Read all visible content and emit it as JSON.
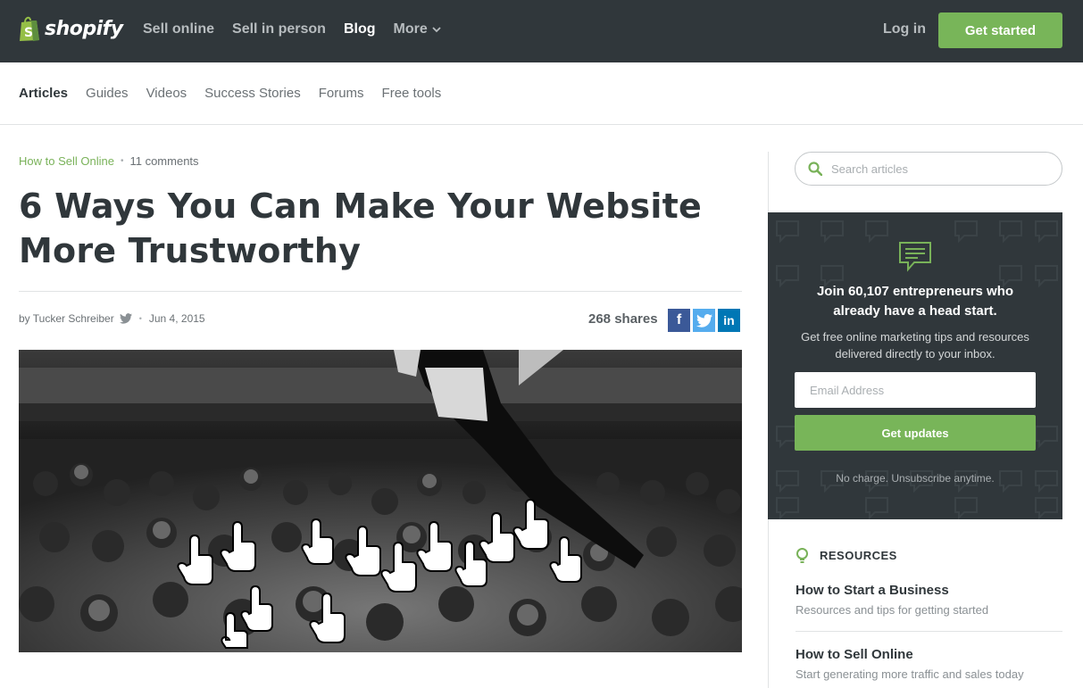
{
  "brand": {
    "logo_text": "shopify",
    "accent": "#78b559",
    "header_bg": "#30373b"
  },
  "top_nav": {
    "items": [
      {
        "label": "Sell online"
      },
      {
        "label": "Sell in person"
      },
      {
        "label": "Blog"
      },
      {
        "label": "More"
      }
    ],
    "active": "Blog",
    "login_label": "Log in",
    "cta_label": "Get started"
  },
  "sub_nav": {
    "items": [
      {
        "label": "Articles"
      },
      {
        "label": "Guides"
      },
      {
        "label": "Videos"
      },
      {
        "label": "Success Stories"
      },
      {
        "label": "Forums"
      },
      {
        "label": "Free tools"
      }
    ],
    "active": "Articles"
  },
  "article": {
    "category": "How to Sell Online",
    "comments": "11 comments",
    "title": "6 Ways You Can Make Your Website More Trustworthy",
    "author": "by Tucker Schreiber",
    "date": "Jun 4, 2015",
    "shares": "268 shares",
    "social": [
      "facebook-icon",
      "twitter-icon",
      "linkedin-icon"
    ]
  },
  "sidebar": {
    "search_placeholder": "Search articles",
    "signup": {
      "headline": "Join 60,107 entrepreneurs who already have a head start.",
      "subtext": "Get free online marketing tips and resources delivered directly to your inbox.",
      "email_placeholder": "Email Address",
      "button_label": "Get updates",
      "note": "No charge. Unsubscribe anytime."
    },
    "resources": {
      "heading": "RESOURCES",
      "items": [
        {
          "title": "How to Start a Business",
          "desc": "Resources and tips for getting started"
        },
        {
          "title": "How to Sell Online",
          "desc": "Start generating more traffic and sales today"
        }
      ]
    }
  }
}
